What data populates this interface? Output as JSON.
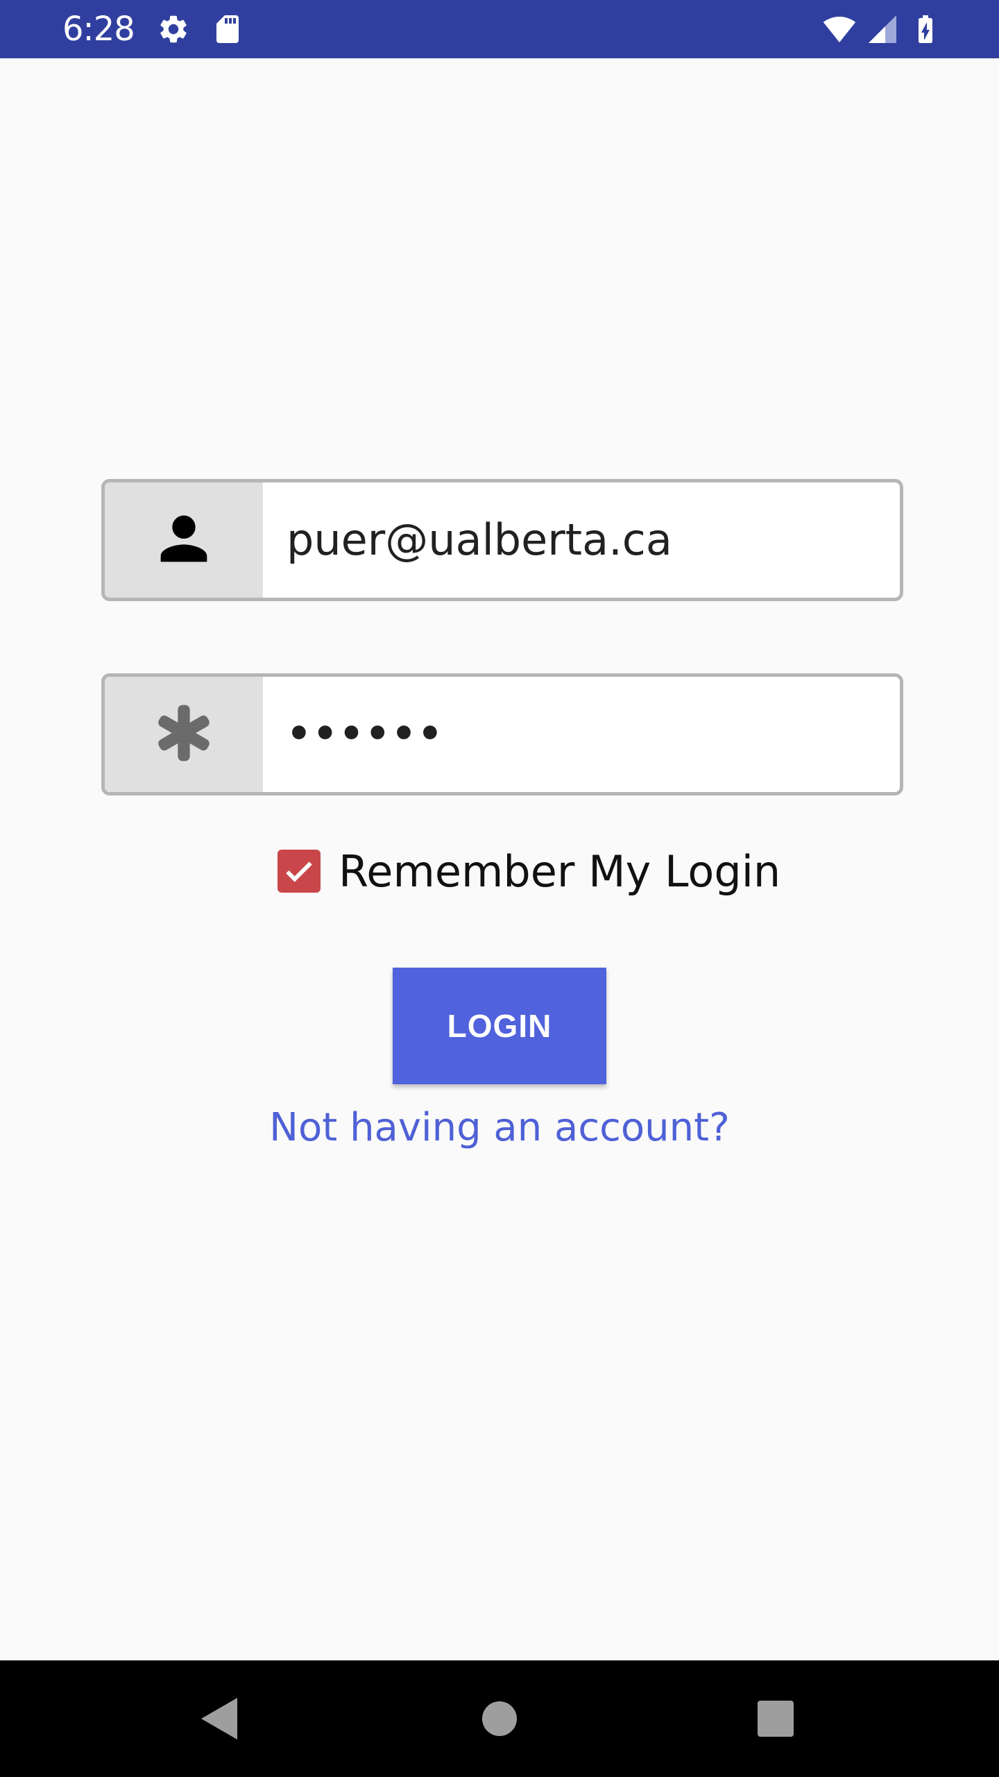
{
  "status_bar": {
    "time": "6:28",
    "icons": [
      "settings-icon",
      "sd-card-icon",
      "wifi-icon",
      "signal-icon",
      "battery-charging-icon"
    ],
    "color": "#303f9f"
  },
  "login_form": {
    "email_value": "puer@ualberta.ca",
    "email_icon": "person-icon",
    "password_value": "••••••",
    "password_icon": "asterisk-icon",
    "remember_label": "Remember My Login",
    "remember_checked": true,
    "checkbox_color": "#c9474a",
    "login_button_label": "LOGIN",
    "login_button_color": "#5062dc",
    "signup_link_text": "Not having an account?",
    "link_color": "#4f61d6"
  },
  "navigation_bar": {
    "icons": [
      "back-icon",
      "home-icon",
      "recents-icon"
    ]
  }
}
